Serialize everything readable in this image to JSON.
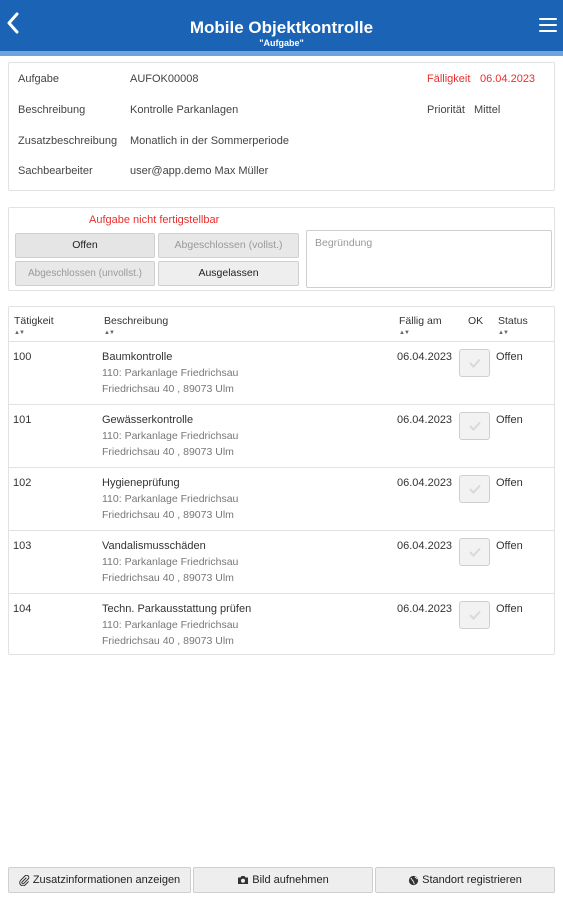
{
  "header": {
    "title": "Mobile Objektkontrolle",
    "subtitle": "\"Aufgabe\"",
    "back_icon": "chevron-left-icon",
    "menu_icon": "hamburger-menu-icon",
    "color": "#1a63b5"
  },
  "info": {
    "aufgabe_label": "Aufgabe",
    "aufgabe_value": "AUFOK00008",
    "faelligkeit_label": "Fälligkeit",
    "faelligkeit_value": "06.04.2023",
    "beschreibung_label": "Beschreibung",
    "beschreibung_value": "Kontrolle Parkanlagen",
    "prioritaet_label": "Priorität",
    "prioritaet_value": "Mittel",
    "zusatz_label": "Zusatzbeschreibung",
    "zusatz_value": "Monatlich in der Sommerperiode",
    "sachbearbeiter_label": "Sachbearbeiter",
    "sachbearbeiter_value": "user@app.demo Max Müller"
  },
  "status": {
    "warning": "Aufgabe nicht fertigstellbar",
    "offen": "Offen",
    "abgeschlossen_vollst": "Abgeschlossen (vollst.)",
    "abgeschlossen_unvollst": "Abgeschlossen (unvollst.)",
    "ausgelassen": "Ausgelassen",
    "begruendung_placeholder": "Begründung"
  },
  "table": {
    "headers": {
      "taetigkeit": "Tätigkeit",
      "beschreibung": "Beschreibung",
      "faellig": "Fällig am",
      "ok": "OK",
      "status": "Status"
    },
    "rows": [
      {
        "id": "100",
        "name": "Baumkontrolle",
        "loc1": "110: Parkanlage Friedrichsau",
        "loc2": "Friedrichsau 40 , 89073 Ulm",
        "due": "06.04.2023",
        "status": "Offen"
      },
      {
        "id": "101",
        "name": "Gewässerkontrolle",
        "loc1": "110: Parkanlage Friedrichsau",
        "loc2": "Friedrichsau 40 , 89073 Ulm",
        "due": "06.04.2023",
        "status": "Offen"
      },
      {
        "id": "102",
        "name": "Hygieneprüfung",
        "loc1": "110: Parkanlage Friedrichsau",
        "loc2": "Friedrichsau 40 , 89073 Ulm",
        "due": "06.04.2023",
        "status": "Offen"
      },
      {
        "id": "103",
        "name": "Vandalismusschäden",
        "loc1": "110: Parkanlage Friedrichsau",
        "loc2": "Friedrichsau 40 , 89073 Ulm",
        "due": "06.04.2023",
        "status": "Offen"
      },
      {
        "id": "104",
        "name": "Techn. Parkausstattung prüfen",
        "loc1": "110: Parkanlage Friedrichsau",
        "loc2": "Friedrichsau 40 , 89073 Ulm",
        "due": "06.04.2023",
        "status": "Offen"
      }
    ]
  },
  "footer": {
    "zusatzinfo": "Zusatzinformationen anzeigen",
    "bild": "Bild aufnehmen",
    "standort": "Standort registrieren",
    "zusatzinfo_icon": "paperclip-icon",
    "bild_icon": "camera-icon",
    "standort_icon": "globe-icon"
  }
}
